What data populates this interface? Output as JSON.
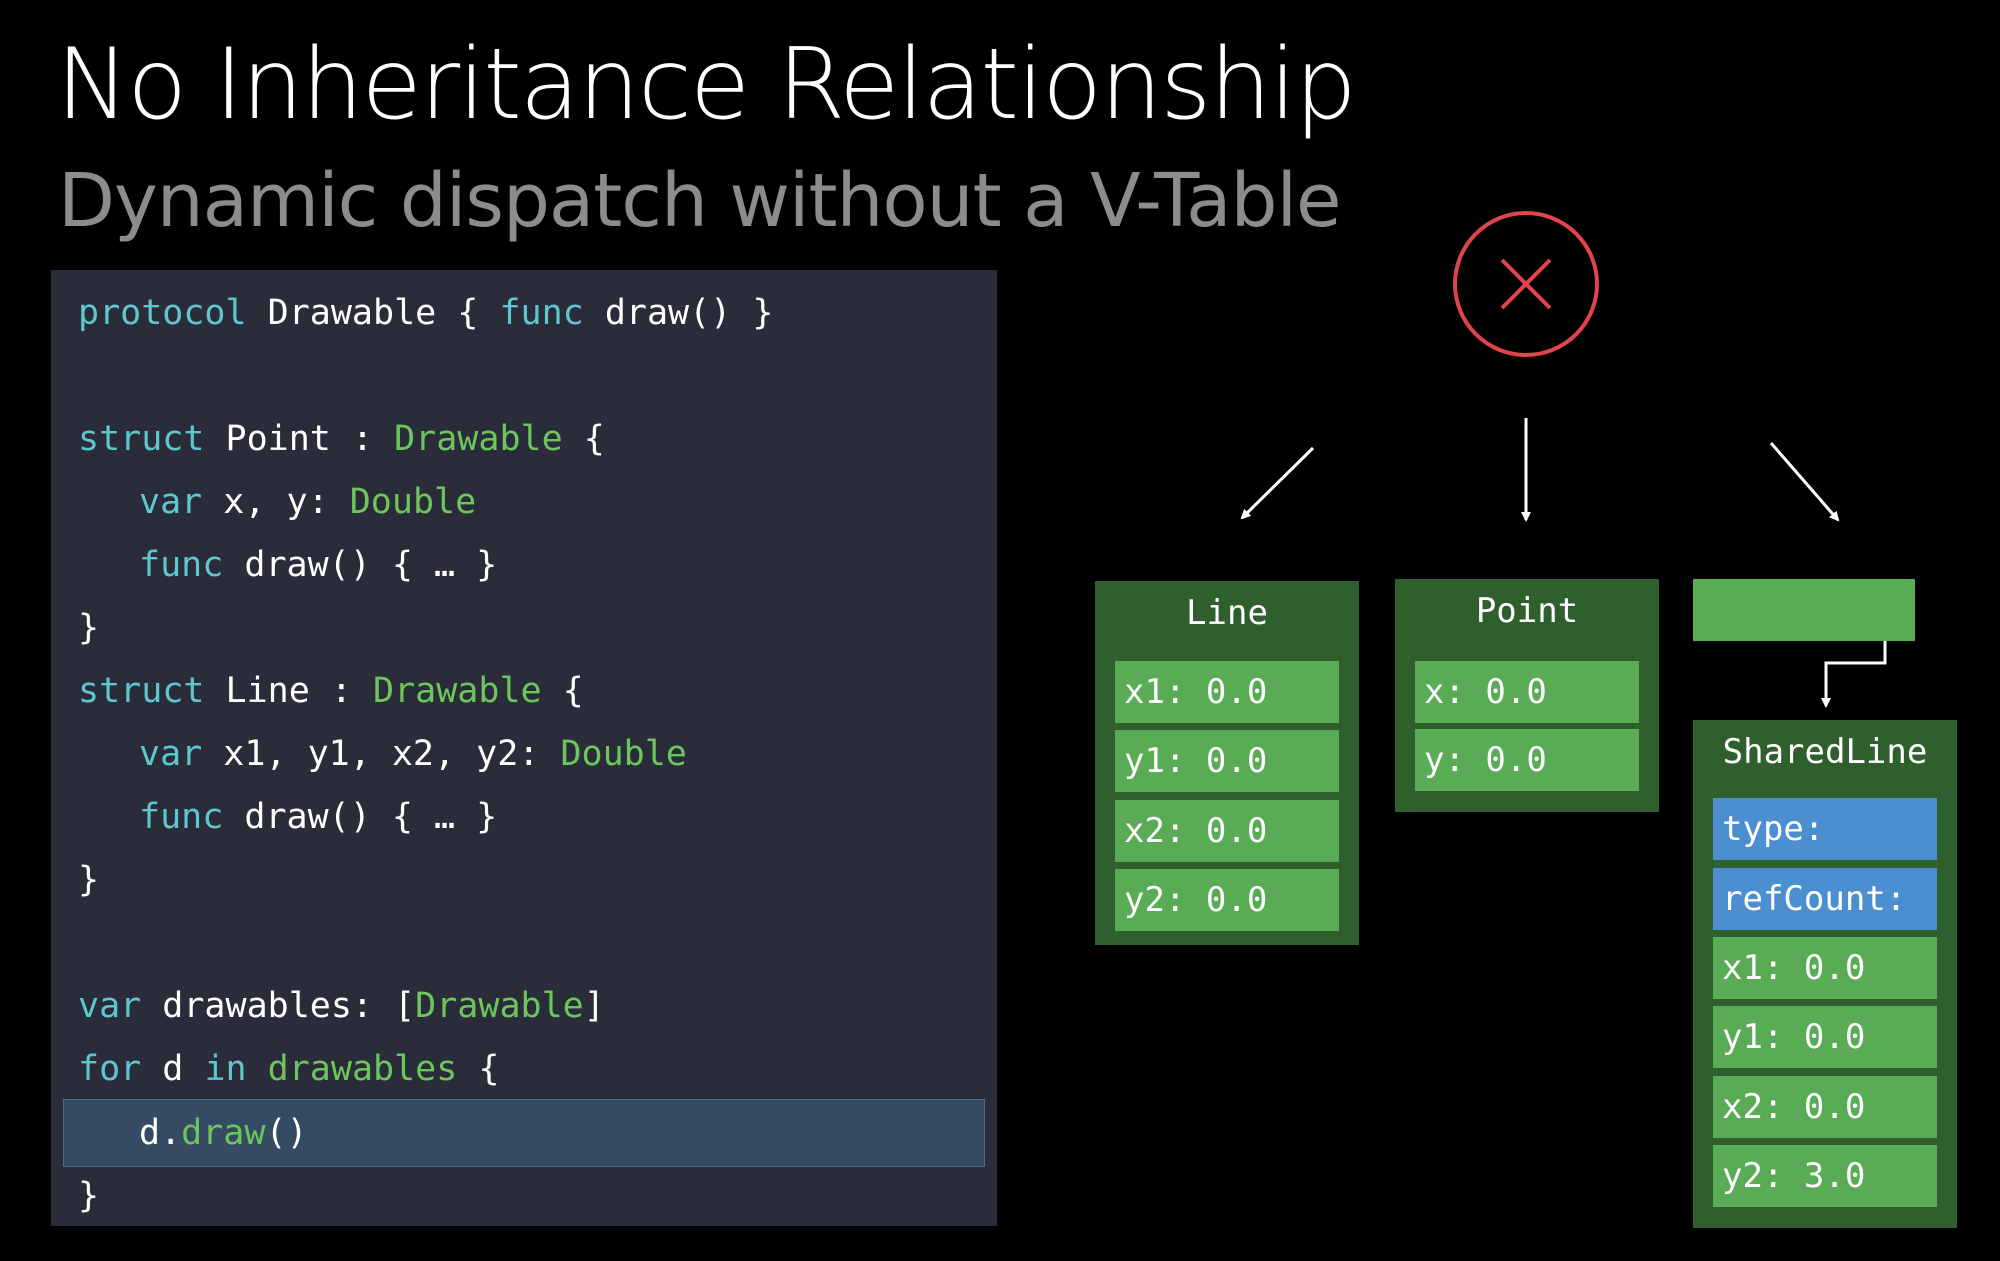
{
  "slide": {
    "title": "No Inheritance Relationship",
    "subtitle": "Dynamic dispatch without a V-Table"
  },
  "code": {
    "line1": {
      "kw": "protocol",
      "name": " Drawable { ",
      "kw2": "func",
      "rest": " draw() }"
    },
    "line3": {
      "kw": "struct",
      "name": " Point : ",
      "type": "Drawable",
      "rest": " {"
    },
    "line4": {
      "kw": "var",
      "rest": " x, y: ",
      "type": "Double"
    },
    "line5": {
      "kw": "func",
      "rest": " draw() { … }"
    },
    "line6": {
      "rest": "}"
    },
    "line7": {
      "kw": "struct",
      "name": " Line : ",
      "type": "Drawable",
      "rest": " {"
    },
    "line8": {
      "kw": "var",
      "rest": " x1, y1, x2, y2: ",
      "type": "Double"
    },
    "line9": {
      "kw": "func",
      "rest": " draw() { … }"
    },
    "line10": {
      "rest": "}"
    },
    "line12": {
      "kw": "var",
      "name": " drawables: [",
      "type": "Drawable",
      "rest": "]"
    },
    "line13": {
      "kw": "for",
      "name": " d ",
      "kw2": "in",
      "type": " drawables",
      "rest": " {"
    },
    "line14": {
      "name": "d.",
      "type": "draw",
      "rest": "()"
    },
    "line15": {
      "rest": "}"
    }
  },
  "diagram": {
    "no_vtable_icon": "x-icon",
    "line_box": {
      "title": "Line",
      "fields": [
        "x1: 0.0",
        "y1: 0.0",
        "x2: 0.0",
        "y2: 0.0"
      ]
    },
    "point_box": {
      "title": "Point",
      "fields": [
        "x: 0.0",
        "y: 0.0"
      ]
    },
    "shared_line_box": {
      "title": "SharedLine",
      "header_fields": [
        "type:",
        "refCount:"
      ],
      "fields": [
        "x1: 0.0",
        "y1: 0.0",
        "x2: 0.0",
        "y2: 3.0"
      ]
    }
  },
  "colors": {
    "keyword": "#5dc6cf",
    "type": "#6cc65c",
    "box_dark_green": "#2f5f2c",
    "field_green": "#5aab56",
    "field_blue": "#4c8fd0",
    "x_icon_red": "#e0454b"
  }
}
